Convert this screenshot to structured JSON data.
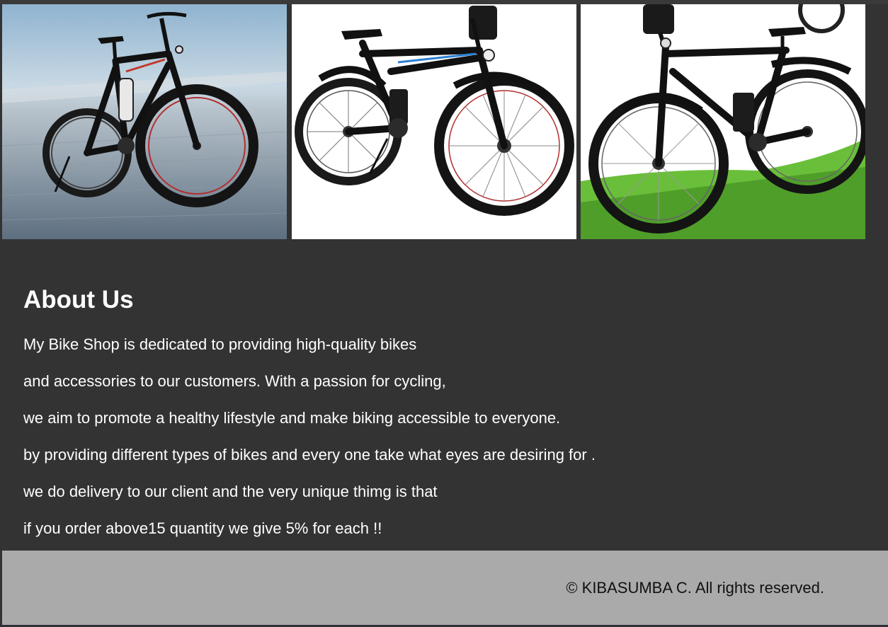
{
  "gallery": {
    "images": [
      {
        "name": "bike-image-1",
        "scene": "e-bike on blurred road"
      },
      {
        "name": "bike-image-2",
        "scene": "folding e-bike on white"
      },
      {
        "name": "bike-image-3",
        "scene": "folding e-bike on grass"
      }
    ]
  },
  "about": {
    "heading": "About Us",
    "lines": [
      "My Bike Shop is dedicated to providing high-quality bikes",
      "and accessories to our customers. With a passion for cycling,",
      "we aim to promote a healthy lifestyle and make biking accessible to everyone.",
      "by providing different types of bikes and every one take what eyes are desiring for .",
      "we do delivery to our client and the very unique thimg is that",
      "if you order above15 quantity we give 5% for each !!"
    ]
  },
  "footer": {
    "copyright": "© KIBASUMBA C. All rights reserved."
  },
  "colors": {
    "page_background": "#333333",
    "footer_background": "#aaaaaa",
    "text_light": "#ffffff",
    "text_dark": "#111111",
    "bike_accent_red": "#c0392b",
    "bike_accent_blue": "#2a7fd4",
    "grass_green": "#6abf3a"
  }
}
